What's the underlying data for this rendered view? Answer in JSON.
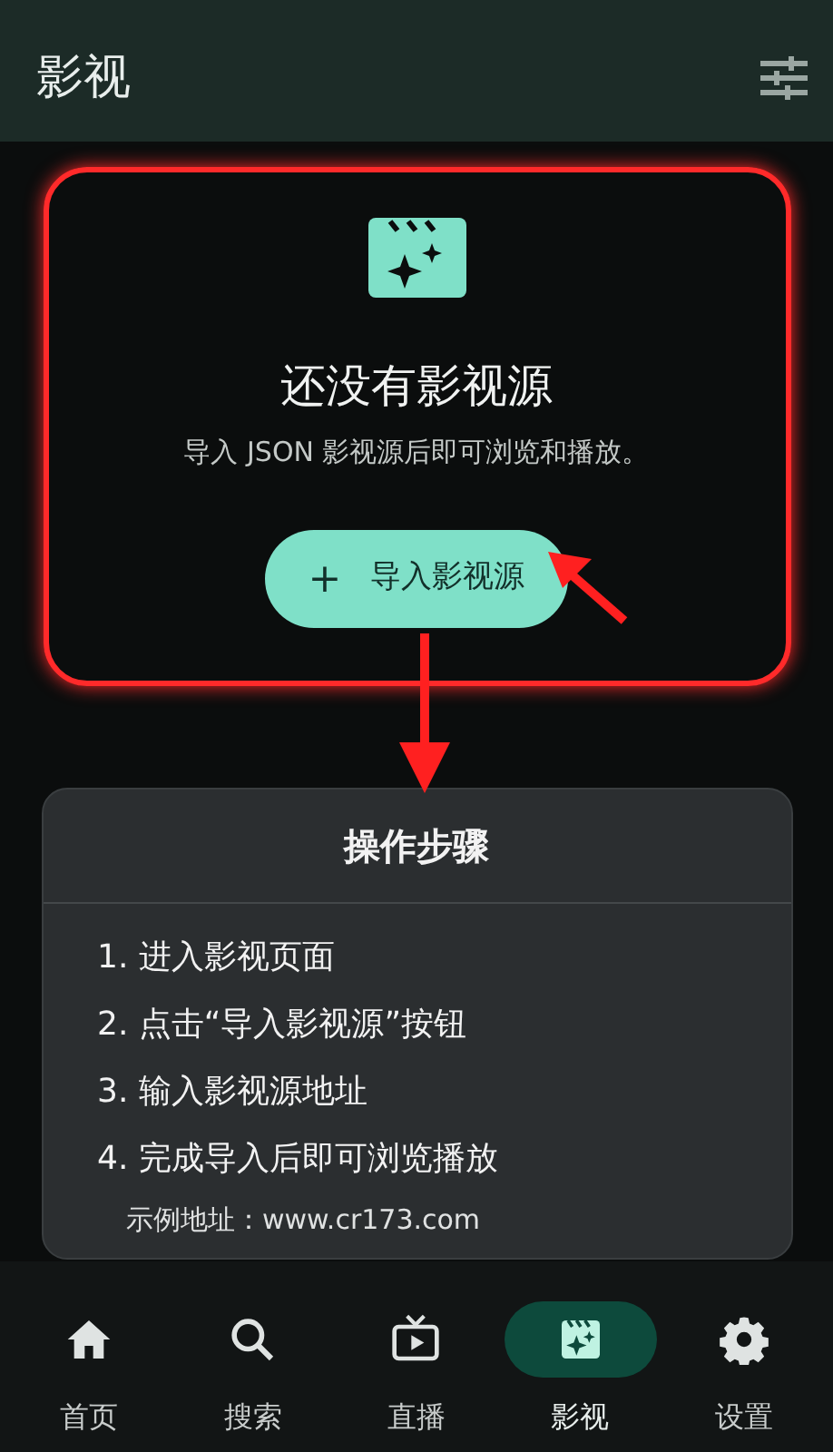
{
  "header": {
    "title": "影视"
  },
  "empty_state": {
    "title": "还没有影视源",
    "message": "导入 JSON 影视源后即可浏览和播放。",
    "button": {
      "icon": "+",
      "label": "导入影视源"
    }
  },
  "instructions": {
    "title": "操作步骤",
    "steps": [
      "1. 进入影视页面",
      "2. 点击“导入影视源”按钮",
      "3. 输入影视源地址",
      "4. 完成导入后即可浏览播放"
    ],
    "example": "示例地址：www.cr173.com"
  },
  "nav": [
    {
      "kind": "home",
      "label": "首页",
      "selected": false
    },
    {
      "kind": "search",
      "label": "搜索",
      "selected": false
    },
    {
      "kind": "tv",
      "label": "直播",
      "selected": false
    },
    {
      "kind": "clapper",
      "label": "影视",
      "selected": true
    },
    {
      "kind": "gear",
      "label": "设置",
      "selected": false
    }
  ]
}
